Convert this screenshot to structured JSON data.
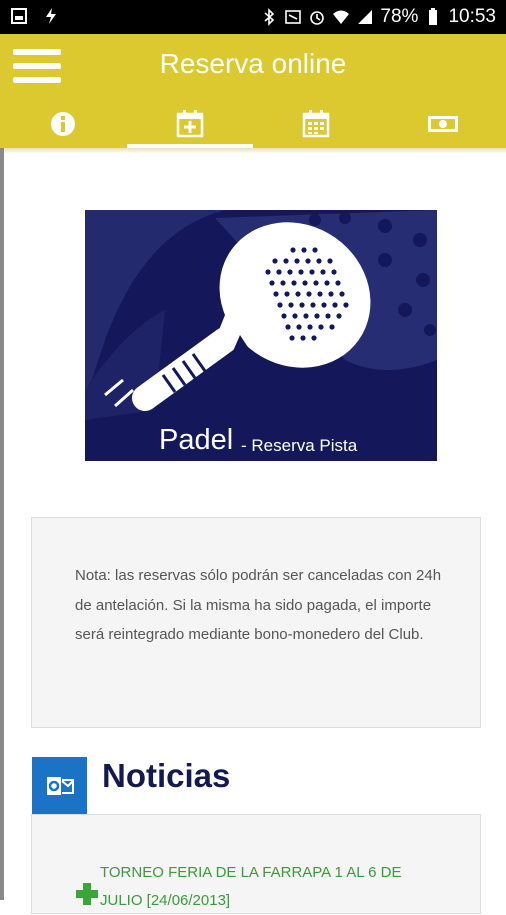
{
  "status_bar": {
    "battery": "78%",
    "time": "10:53"
  },
  "header": {
    "title": "Reserva online",
    "tabs": [
      {
        "icon": "info-icon",
        "active": false
      },
      {
        "icon": "calendar-add-icon",
        "active": true
      },
      {
        "icon": "calendar-icon",
        "active": false
      },
      {
        "icon": "money-icon",
        "active": false
      }
    ]
  },
  "banner": {
    "title": "Padel",
    "subtitle": "- Reserva Pista"
  },
  "note": {
    "text": "Nota: las reservas sólo podrán ser canceladas con 24h de antelación. Si la misma ha sido pagada, el importe será reintegrado mediante bono-monedero del Club."
  },
  "news": {
    "title": "Noticias",
    "items": [
      {
        "text": "TORNEO FERIA DE LA FARRAPA 1 AL 6 DE JULIO [24/06/2013]"
      }
    ]
  },
  "colors": {
    "accent": "#dcc92f",
    "banner_bg": "#14185a",
    "news_green": "#3a9b3a"
  }
}
